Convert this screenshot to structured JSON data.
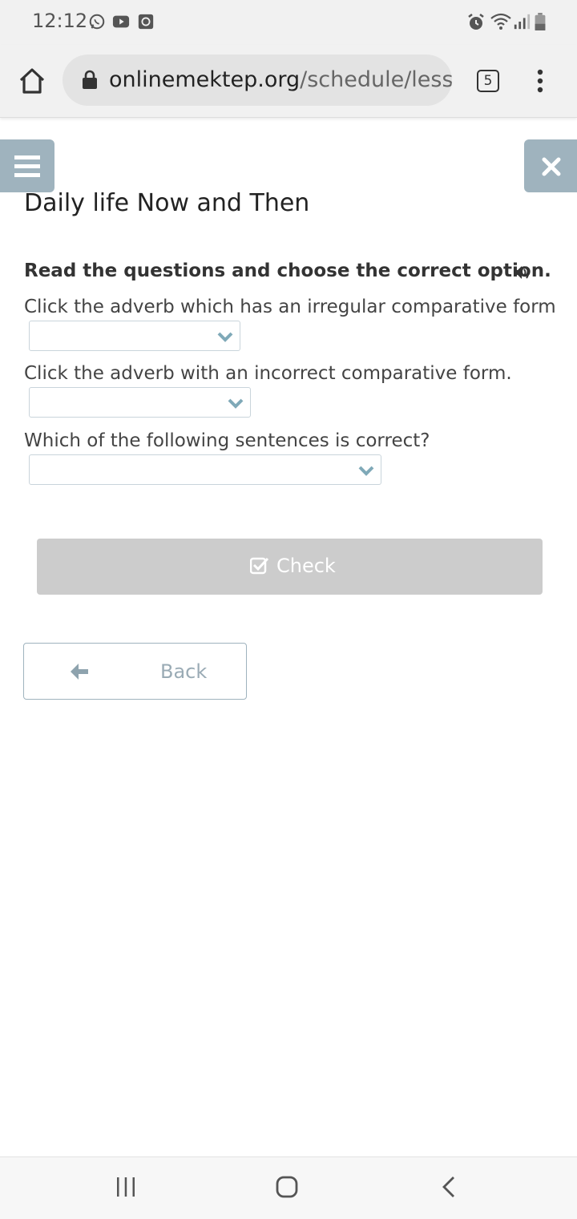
{
  "status_bar": {
    "time": "12:12",
    "left_icons": [
      "whatsapp-icon",
      "youtube-icon",
      "sync-icon"
    ],
    "right_icons": [
      "alarm-icon",
      "wifi-icon",
      "signal-icon",
      "battery-icon"
    ]
  },
  "browser": {
    "url_domain": "onlinemektep.org",
    "url_path": "/schedule/less",
    "tab_count": "5"
  },
  "lesson": {
    "title": "Daily life Now and Then",
    "instructions": "Read the questions and choose the correct option.",
    "questions": [
      {
        "text": "Click the adverb which has an irregular comparative form",
        "selected": ""
      },
      {
        "text": "Click the adverb with an incorrect comparative form.",
        "selected": ""
      },
      {
        "text": "Which of the following sentences is correct?",
        "selected": ""
      }
    ],
    "check_label": "Check",
    "back_label": "Back"
  },
  "colors": {
    "accent": "#9fb3be",
    "check_button_bg": "#cccccc",
    "chevron": "#7fa9b8"
  }
}
